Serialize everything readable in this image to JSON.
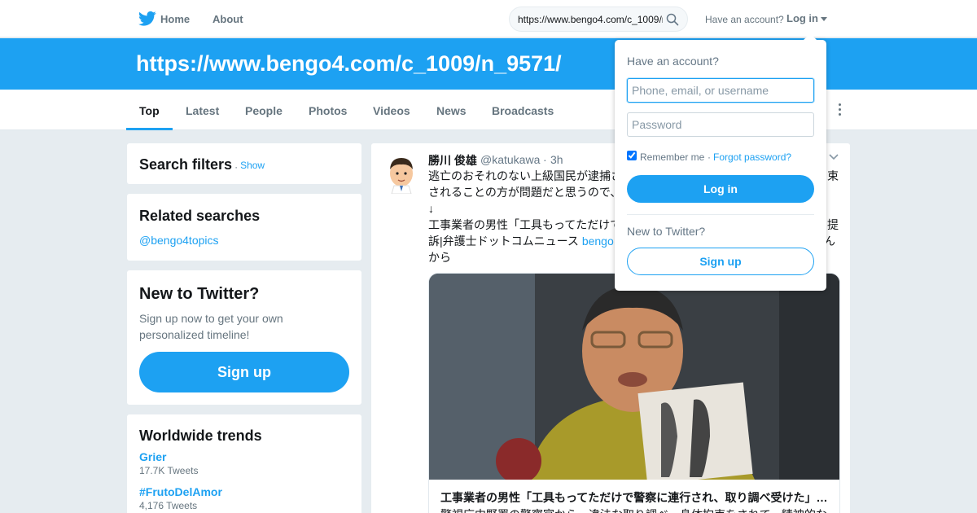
{
  "nav": {
    "home_label": "Home",
    "about_label": "About",
    "search_value": "https://www.bengo4.com/c_1009/n_9571/",
    "have_account": "Have an account?",
    "login_label": "Log in",
    "bird_icon": "twitter-bird-icon",
    "search_icon": "search-icon"
  },
  "banner": {
    "title": "https://www.bengo4.com/c_1009/n_9571/"
  },
  "tabs": [
    {
      "label": "Top",
      "active": true
    },
    {
      "label": "Latest"
    },
    {
      "label": "People"
    },
    {
      "label": "Photos"
    },
    {
      "label": "Videos"
    },
    {
      "label": "News"
    },
    {
      "label": "Broadcasts"
    }
  ],
  "search_filters": {
    "title": "Search filters",
    "separator": "·",
    "show_label": "Show"
  },
  "related": {
    "title": "Related searches",
    "link": "@bengo4topics"
  },
  "new_to_twitter": {
    "title": "New to Twitter?",
    "desc": "Sign up now to get your own personalized timeline!",
    "signup_label": "Sign up"
  },
  "trends": {
    "title": "Worldwide trends",
    "items": [
      {
        "name": "Grier",
        "count": "17.7K Tweets"
      },
      {
        "name": "#FrutoDelAmor",
        "count": "4,176 Tweets"
      }
    ]
  },
  "tweet": {
    "name": "勝川 俊雄",
    "handle": "@katukawa",
    "separator": "·",
    "time": "3h",
    "line1": "逃亡のおそれのない上級国民が逮捕さ",
    "line1_end": "束",
    "line2": "されることの方が問題だと思うので、",
    "line3": "↓",
    "line4": "工事業者の男性「工具もってただけで",
    "line4_end": "提",
    "line5_pre": "訴|弁護士ドットコムニュース ",
    "line5_link": "bengo",
    "line5_end": "ん",
    "line6": "から",
    "card_title": "工事業者の男性「工具もってただけで警察に連行され、取り調べ受けた」…",
    "card_desc": "警視庁中野署の警察官から、違法な取り調べ・身体拘束をされて、精神的な"
  },
  "login_dropdown": {
    "title": "Have an account?",
    "username_placeholder": "Phone, email, or username",
    "password_placeholder": "Password",
    "remember_label": "Remember me",
    "separator": "·",
    "forgot_label": "Forgot password?",
    "login_button": "Log in",
    "new_label": "New to Twitter?",
    "signup_button": "Sign up",
    "remember_checked": true
  },
  "colors": {
    "accent": "#1da1f2",
    "background": "#e6ecf0"
  }
}
